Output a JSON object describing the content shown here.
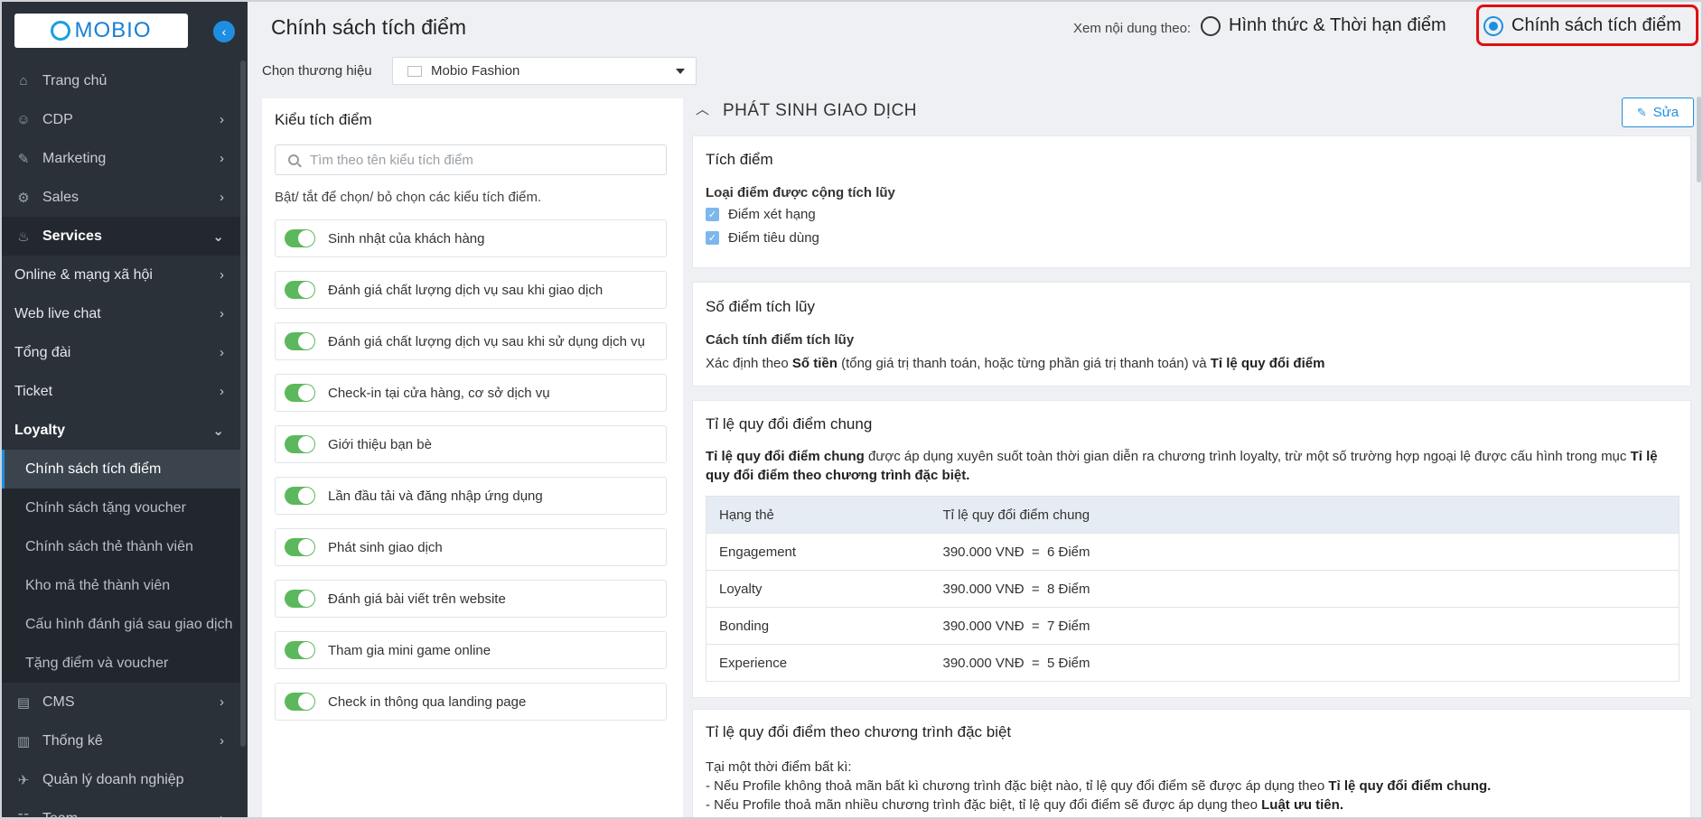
{
  "sidebar": {
    "logo_text": "MOBIO",
    "nav": [
      {
        "label": "Trang chủ",
        "icon": "home-icon",
        "type": "top"
      },
      {
        "label": "CDP",
        "icon": "user-icon",
        "type": "top",
        "chev": "›"
      },
      {
        "label": "Marketing",
        "icon": "megaphone-icon",
        "type": "top",
        "chev": "›"
      },
      {
        "label": "Sales",
        "icon": "handshake-icon",
        "type": "top",
        "chev": "›"
      },
      {
        "label": "Services",
        "icon": "service-icon",
        "type": "active",
        "chev": "⌄"
      },
      {
        "label": "Online & mạng xã hội",
        "type": "plain",
        "chev": "›"
      },
      {
        "label": "Web live chat",
        "type": "plain",
        "chev": "›"
      },
      {
        "label": "Tổng đài",
        "type": "plain",
        "chev": "›"
      },
      {
        "label": "Ticket",
        "type": "plain",
        "chev": "›"
      },
      {
        "label": "Loyalty",
        "type": "bold",
        "chev": "⌄"
      }
    ],
    "loyalty_sub": [
      "Chính sách tích điểm",
      "Chính sách tặng voucher",
      "Chính sách thẻ thành viên",
      "Kho mã thẻ thành viên",
      "Cấu hình đánh giá sau giao dịch",
      "Tặng điểm và voucher"
    ],
    "nav_bottom": [
      {
        "label": "CMS",
        "icon": "cms-icon",
        "chev": "›"
      },
      {
        "label": "Thống kê",
        "icon": "chart-icon",
        "chev": "›"
      },
      {
        "label": "Quản lý doanh nghiệp",
        "icon": "rocket-icon"
      },
      {
        "label": "Team",
        "icon": "team-icon",
        "chev": "›"
      }
    ]
  },
  "header": {
    "title": "Chính sách tích điểm",
    "view_label": "Xem nội dung theo:",
    "option_a": "Hình thức & Thời hạn điểm",
    "option_b": "Chính sách tích điểm",
    "selected": "option_b"
  },
  "brand": {
    "label": "Chọn thương hiệu",
    "value": "Mobio Fashion"
  },
  "left_panel": {
    "title": "Kiểu tích điểm",
    "search_placeholder": "Tìm theo tên kiểu tích điểm",
    "hint": "Bật/ tắt để chọn/ bỏ chọn các kiểu tích điểm.",
    "items": [
      "Sinh nhật của khách hàng",
      "Đánh giá chất lượng dịch vụ sau khi giao dịch",
      "Đánh giá chất lượng dịch vụ sau khi sử dụng dịch vụ",
      "Check-in tại cửa hàng, cơ sở dịch vụ",
      "Giới thiệu bạn bè",
      "Lần đầu tải và đăng nhập ứng dụng",
      "Phát sinh giao dịch",
      "Đánh giá bài viết trên website",
      "Tham gia mini game online",
      "Check in thông qua landing page"
    ]
  },
  "section": {
    "title": "PHÁT SINH GIAO DỊCH",
    "edit_label": "Sửa",
    "accumulate": {
      "title": "Tích điểm",
      "type_label": "Loại điểm được cộng tích lũy",
      "check_1": "Điểm xét hạng",
      "check_2": "Điểm tiêu dùng"
    },
    "points": {
      "title": "Số điểm tích lũy",
      "method_label": "Cách tính điểm tích lũy",
      "method_pre": "Xác định theo ",
      "method_b1": "Số tiền",
      "method_mid": " (tổng giá trị thanh toán, hoặc từng phần giá trị thanh toán) và ",
      "method_b2": "Tỉ lệ quy đổi điểm"
    },
    "rate": {
      "title": "Tỉ lệ quy đổi điểm chung",
      "desc_b1": "Tỉ lệ quy đổi điểm chung",
      "desc_mid": " được áp dụng xuyên suốt toàn thời gian diễn ra chương trình loyalty, trừ một số trường hợp ngoại lệ được cấu hình trong mục ",
      "desc_b2": "Tỉ lệ quy đổi điểm theo chương trình đặc biệt.",
      "col_1": "Hạng thẻ",
      "col_2": "Tỉ lệ quy đổi điểm chung",
      "rows": [
        {
          "tier": "Engagement",
          "rate": "390.000 VNĐ  =  6 Điểm"
        },
        {
          "tier": "Loyalty",
          "rate": "390.000 VNĐ  =  8 Điểm"
        },
        {
          "tier": "Bonding",
          "rate": "390.000 VNĐ  =  7 Điểm"
        },
        {
          "tier": "Experience",
          "rate": "390.000 VNĐ  =  5 Điểm"
        }
      ]
    },
    "special": {
      "title": "Tỉ lệ quy đổi điểm theo chương trình đặc biệt",
      "line_0": "Tại một thời điểm bất kì:",
      "line_1_pre": "- Nếu Profile không thoả mãn bất kì chương trình đặc biệt nào, tỉ lệ quy đổi điểm sẽ được áp dụng theo ",
      "line_1_b": "Tỉ lệ quy đổi điểm chung.",
      "line_2_pre": "- Nếu Profile thoả mãn nhiều chương trình đặc biệt, tỉ lệ quy đổi điểm sẽ được áp dụng theo ",
      "line_2_b": "Luật ưu tiên."
    }
  }
}
